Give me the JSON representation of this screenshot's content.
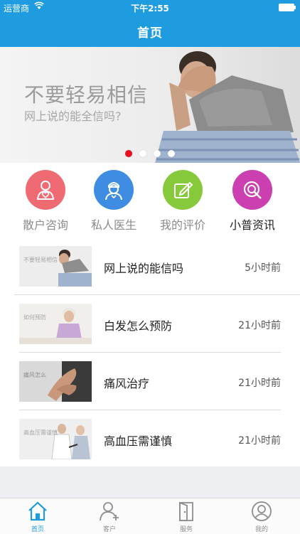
{
  "status_bar": {
    "carrier": "运营商",
    "time": "下午2:55"
  },
  "nav": {
    "title": "首页"
  },
  "banner": {
    "headline": "不要轻易相信",
    "subline": "网上说的能全信吗?",
    "active_dot": 1,
    "dot_count": 4
  },
  "categories": [
    {
      "label": "散户咨询",
      "icon": "heart-person-icon",
      "color": "#f06a73"
    },
    {
      "label": "私人医生",
      "icon": "doctor-icon",
      "color": "#3f8de3"
    },
    {
      "label": "我的评价",
      "icon": "edit-icon",
      "color": "#86c93a"
    },
    {
      "label": "小普资讯",
      "icon": "news-icon",
      "color": "#cb3fb0"
    }
  ],
  "articles": [
    {
      "title": "网上说的能信吗",
      "time": "5小时前",
      "thumb_text": "不要轻易相信"
    },
    {
      "title": "白发怎么预防",
      "time": "21小时前",
      "thumb_text": "如何预防"
    },
    {
      "title": "痛风治疗",
      "time": "21小时前",
      "thumb_text": "痛风怎么"
    },
    {
      "title": "高血压需谨慎",
      "time": "21小时前",
      "thumb_text": "高血压需谨慎"
    }
  ],
  "tabs": [
    {
      "label": "首页",
      "icon": "home-icon"
    },
    {
      "label": "客户",
      "icon": "add-user-icon"
    },
    {
      "label": "服务",
      "icon": "door-icon"
    },
    {
      "label": "我的",
      "icon": "profile-icon"
    }
  ],
  "colors": {
    "primary": "#1f9ce0",
    "active_dot": "#e8101e"
  }
}
